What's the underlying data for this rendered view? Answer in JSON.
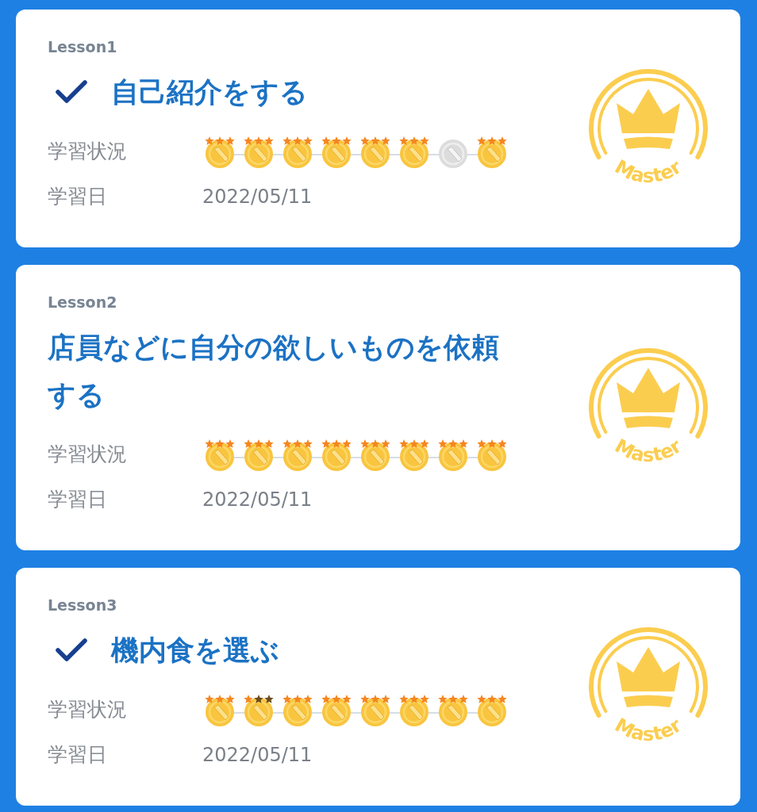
{
  "lessons": [
    {
      "lesson": "Lesson1",
      "checked": true,
      "title": "自己紹介をする",
      "status_label": "学習状況",
      "date_label": "学習日",
      "date": "2022/05/11",
      "badge": "Master",
      "medals": [
        {
          "stars": 3
        },
        {
          "stars": 3
        },
        {
          "stars": 3
        },
        {
          "stars": 3
        },
        {
          "stars": 3
        },
        {
          "stars": 3
        },
        {
          "kind": "locked"
        },
        {
          "stars": 3
        }
      ]
    },
    {
      "lesson": "Lesson2",
      "checked": false,
      "title": "店員などに自分の欲しいものを依頼する",
      "status_label": "学習状況",
      "date_label": "学習日",
      "date": "2022/05/11",
      "badge": "Master",
      "medals": [
        {
          "stars": 3
        },
        {
          "stars": 3
        },
        {
          "stars": 3
        },
        {
          "stars": 3
        },
        {
          "stars": 3
        },
        {
          "stars": 3
        },
        {
          "stars": 3
        },
        {
          "stars": 3
        }
      ]
    },
    {
      "lesson": "Lesson3",
      "checked": true,
      "title": "機内食を選ぶ",
      "status_label": "学習状況",
      "date_label": "学習日",
      "date": "2022/05/11",
      "badge": "Master",
      "medals": [
        {
          "stars": 3
        },
        {
          "stars": 1
        },
        {
          "stars": 3
        },
        {
          "stars": 3
        },
        {
          "stars": 3
        },
        {
          "stars": 3
        },
        {
          "stars": 3
        },
        {
          "stars": 3
        }
      ]
    }
  ]
}
